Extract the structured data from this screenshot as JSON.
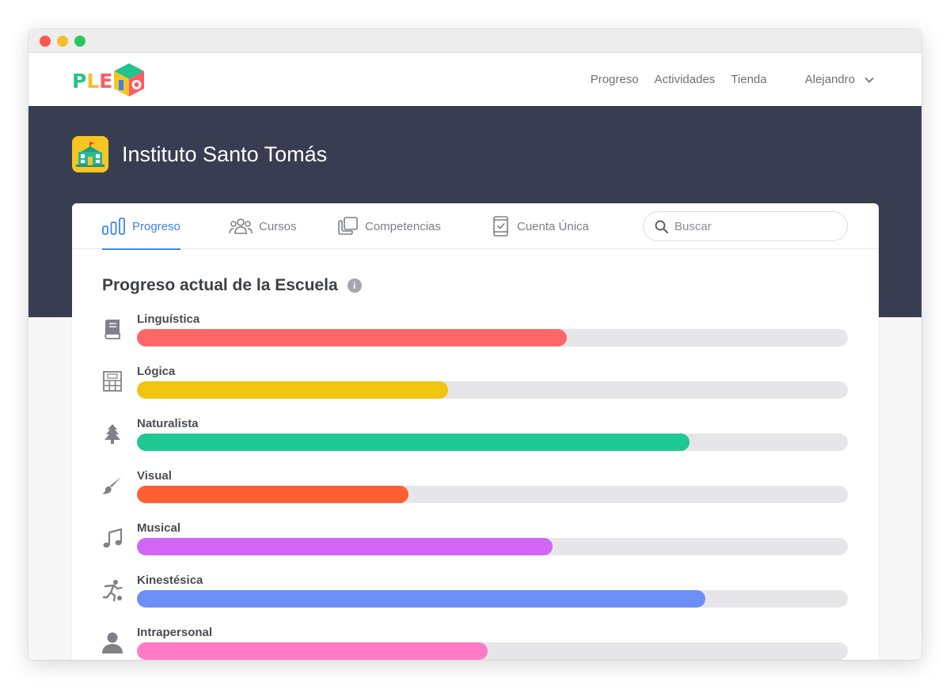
{
  "brand": {
    "letters": [
      "P",
      "L",
      "E"
    ],
    "letter_colors": [
      "#22c38e",
      "#f5c023",
      "#ff5b61"
    ],
    "cube_colors": [
      "#22c38e",
      "#f7c520",
      "#ff5b61",
      "#3e84e8"
    ]
  },
  "nav": {
    "links": [
      "Progreso",
      "Actividades",
      "Tienda"
    ],
    "user": "Alejandro"
  },
  "school": {
    "name": "Instituto Santo Tomás"
  },
  "tabs": [
    {
      "label": "Progreso",
      "icon": "bar-chart-icon",
      "active": true
    },
    {
      "label": "Cursos",
      "icon": "group-icon",
      "active": false
    },
    {
      "label": "Competencias",
      "icon": "copy-icon",
      "active": false
    },
    {
      "label": "Cuenta Única",
      "icon": "device-check-icon",
      "active": false
    }
  ],
  "search": {
    "placeholder": "Buscar"
  },
  "section": {
    "title": "Progreso actual de la Escuela",
    "info": "i"
  },
  "competencies": [
    {
      "label": "Linguística",
      "icon": "book-icon",
      "progress": 0.605,
      "color": "#ff6669"
    },
    {
      "label": "Lógica",
      "icon": "calculator-icon",
      "progress": 0.438,
      "color": "#f1c40f"
    },
    {
      "label": "Naturalista",
      "icon": "tree-icon",
      "progress": 0.777,
      "color": "#1ec891"
    },
    {
      "label": "Visual",
      "icon": "paintbrush-icon",
      "progress": 0.382,
      "color": "#ff5f33"
    },
    {
      "label": "Musical",
      "icon": "music-note-icon",
      "progress": 0.585,
      "color": "#d165f5"
    },
    {
      "label": "Kinestésica",
      "icon": "soccer-player-icon",
      "progress": 0.8,
      "color": "#6b8ff7"
    },
    {
      "label": "Intrapersonal",
      "icon": "person-icon",
      "progress": 0.493,
      "color": "#ff7bc6"
    }
  ]
}
